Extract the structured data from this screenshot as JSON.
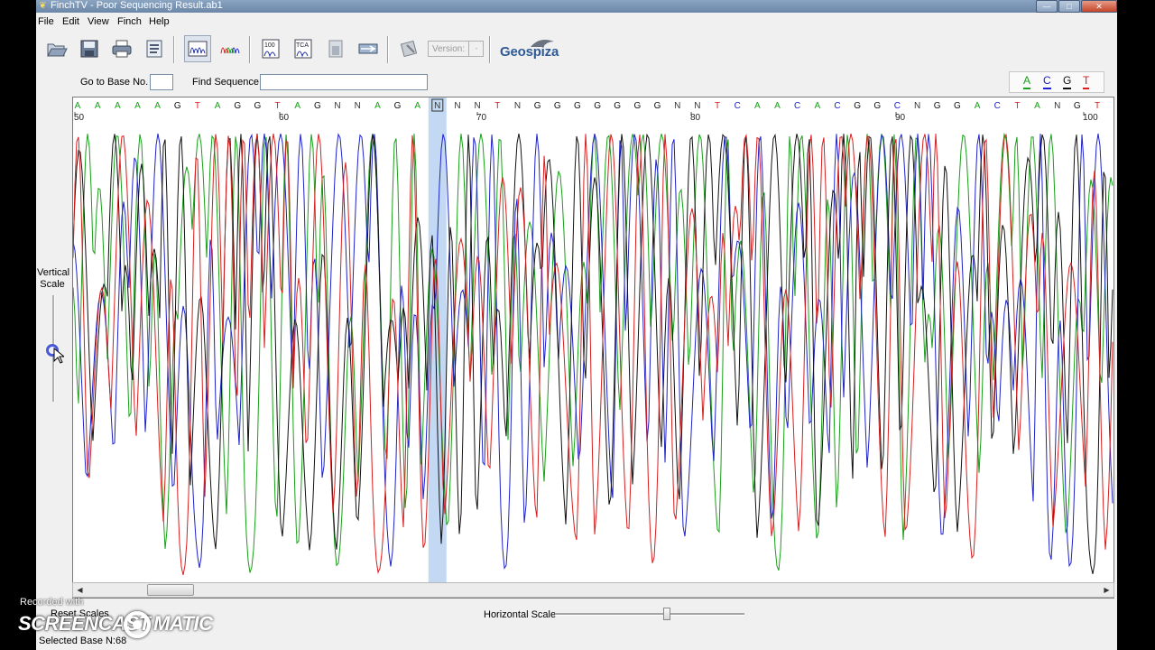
{
  "window": {
    "title": "FinchTV - Poor Sequencing Result.ab1",
    "controls": {
      "minimize": "—",
      "maximize": "□",
      "close": "✕"
    }
  },
  "menu": [
    "File",
    "Edit",
    "View",
    "Finch",
    "Help"
  ],
  "toolbar": {
    "icons": [
      "open-folder-icon",
      "save-disk-icon",
      "print-icon",
      "info-icon",
      "trace-view-icon",
      "multi-trace-view-icon",
      "quality-100-icon",
      "tca-icon",
      "bar-icon",
      "export-icon",
      "database-icon"
    ],
    "version_label": "Version:",
    "version_dropdown": "-",
    "brand": "Geospiza"
  },
  "search": {
    "go_to_base_label": "Go to Base No.",
    "go_to_base_value": "",
    "find_sequence_label": "Find Sequence",
    "find_sequence_value": ""
  },
  "legend": {
    "items": [
      {
        "base": "A",
        "color": "#18a018"
      },
      {
        "base": "C",
        "color": "#1e22c8"
      },
      {
        "base": "G",
        "color": "#111111"
      },
      {
        "base": "T",
        "color": "#d81e1e"
      }
    ]
  },
  "trace": {
    "bases": [
      "A",
      "A",
      "A",
      "A",
      "A",
      "G",
      "T",
      "A",
      "G",
      "G",
      "T",
      "A",
      "G",
      "N",
      "N",
      "A",
      "G",
      "A",
      "N",
      "N",
      "N",
      "T",
      "N",
      "G",
      "G",
      "G",
      "G",
      "G",
      "G",
      "G",
      "N",
      "N",
      "T",
      "C",
      "A",
      "A",
      "C",
      "A",
      "C",
      "G",
      "G",
      "C",
      "N",
      "G",
      "G",
      "A",
      "C",
      "T",
      "A",
      "N",
      "G",
      "T"
    ],
    "position_labels": [
      "50",
      "60",
      "70",
      "80",
      "90",
      "100"
    ],
    "selected_base": "N",
    "colors": {
      "A": "#18a018",
      "C": "#1e22c8",
      "G": "#111111",
      "T": "#d81e1e",
      "N": "#333333"
    }
  },
  "left_panel": {
    "vertical_scale_label": "Vertical Scale",
    "reset_scales_label": "Reset Scales"
  },
  "horizontal_scale_label": "Horizontal Scale",
  "status": {
    "selected_base": "Selected Base N:68"
  },
  "watermark": {
    "recorded_with": "Recorded with",
    "brand_left": "SCREENCAST",
    "brand_right": "MATIC"
  }
}
